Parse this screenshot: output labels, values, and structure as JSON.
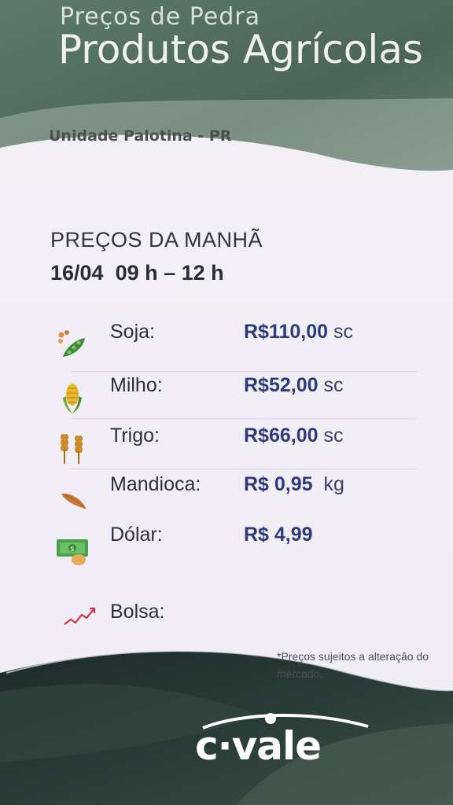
{
  "header": {
    "subtitle": "Preços de Pedra",
    "title": "Produtos Agrícolas",
    "unit": "Unidade Palotina - PR"
  },
  "session": {
    "label": "PREÇOS DA  MANHÃ",
    "date_time": "16/04  09 h – 12 h"
  },
  "prices": [
    {
      "label": "Soja:",
      "value": "R$110,00",
      "unit": "sc",
      "icon": "soy-icon"
    },
    {
      "label": "Milho:",
      "value": "R$52,00",
      "unit": "sc",
      "icon": "corn-icon"
    },
    {
      "label": "Trigo:",
      "value": "R$66,00",
      "unit": "sc",
      "icon": "wheat-icon"
    },
    {
      "label": "Mandioca:",
      "value": "R$ 0,95",
      "unit": "kg",
      "icon": "cassava-icon"
    },
    {
      "label": "Dólar:",
      "value": "R$ 4,99",
      "unit": "",
      "icon": "dollar-icon"
    },
    {
      "label": "Bolsa:",
      "value": "",
      "unit": "",
      "icon": "stock-chart-icon"
    }
  ],
  "footer": {
    "disclaimer": "*Preços sujeitos a alteração do mercado.",
    "brand": "c·vale"
  },
  "colors": {
    "header_green": "#4f6b5c",
    "value_blue": "#2f3a7a",
    "footer_dark": "#243330"
  }
}
